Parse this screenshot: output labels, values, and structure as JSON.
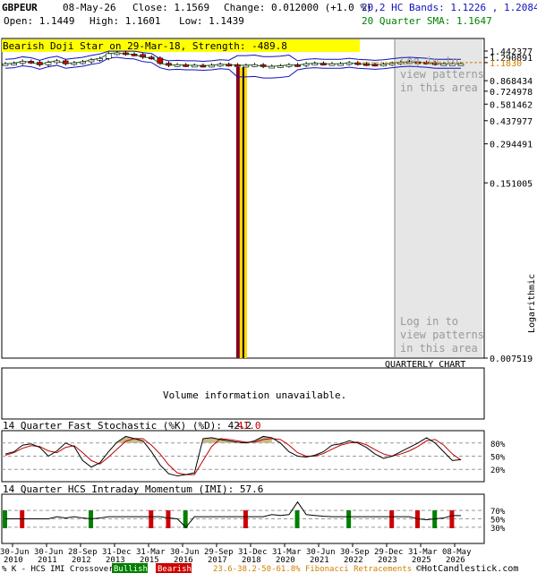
{
  "header": {
    "symbol": "GBPEUR",
    "date": "08-May-26",
    "close": "Close: 1.1569",
    "change": "Change: 0.012000 (+1.0 %)",
    "open": "Open: 1.1449",
    "high": "High: 1.1601",
    "low": "Low: 1.1439",
    "bands": "20,2 HC Bands: 1.1226 , 1.2084",
    "sma": "20 Quarter SMA: 1.1647"
  },
  "colors": {
    "bands": "#1010c0",
    "sma": "#008000",
    "bull": "#008000",
    "bear": "#d00000",
    "pattern_banner": "#ffff00",
    "pattern_bar_dark": "#800020",
    "pattern_bar_light": "#ffd700",
    "login_panel": "#e6e6e6",
    "stoch_k": "#000000",
    "stoch_d": "#c00000",
    "stoch_fill": "#c8b98c",
    "fib": "#d08000"
  },
  "pattern_banner": "Bearish Doji Star on 29-Mar-18, Strength: -489.8",
  "login_text": [
    "Log in to",
    "view patterns",
    "in this area"
  ],
  "chart_label": "QUARTERLY CHART",
  "y_axis_label": "Logarithmic",
  "volume_text": "Volume information unavailable.",
  "stoch_title": "14 Quarter Fast Stochastic (%K) (%D): 42.2",
  "stoch_d_value": "41.0",
  "imi_title": "14 Quarter HCS Intraday Momentum (IMI): 57.6",
  "footer": {
    "crossover": "% K - HCS IMI Crossover:",
    "bullish": "Bullish",
    "bearish": "Bearish",
    "fib": "23.6-38.2-50-61.8% Fibonacci Retracements",
    "copyright": "©HotCandlestick.com"
  },
  "chart_data": {
    "type": "candlestick",
    "scale": "logarithmic",
    "ylim": [
      0.007519,
      1.442377
    ],
    "y_ticks": [
      "1.442377",
      "1.290891",
      "1.1830",
      "0.868434",
      "0.724978",
      "0.581462",
      "0.437977",
      "0.294491",
      "0.151005",
      "0.007519"
    ],
    "y_tick_values": [
      1.442377,
      1.290891,
      1.183,
      0.868434,
      0.724978,
      0.581462,
      0.437977,
      0.294491,
      0.151005,
      0.007519
    ],
    "x_ticks": [
      [
        "30-Jun",
        "2010"
      ],
      [
        "30-Jun",
        "2011"
      ],
      [
        "28-Sep",
        "2012"
      ],
      [
        "31-Dec",
        "2013"
      ],
      [
        "31-Mar",
        "2015"
      ],
      [
        "30-Jun",
        "2016"
      ],
      [
        "29-Sep",
        "2017"
      ],
      [
        "31-Dec",
        "2018"
      ],
      [
        "31-Mar",
        "2020"
      ],
      [
        "30-Jun",
        "2021"
      ],
      [
        "30-Sep",
        "2022"
      ],
      [
        "29-Dec",
        "2023"
      ],
      [
        "31-Mar",
        "2025"
      ],
      [
        "08-May",
        "2026"
      ]
    ],
    "pattern_date": "29-Mar-18",
    "close_values": [
      1.16,
      1.17,
      1.21,
      1.19,
      1.14,
      1.19,
      1.22,
      1.16,
      1.18,
      1.2,
      1.24,
      1.27,
      1.38,
      1.4,
      1.37,
      1.36,
      1.3,
      1.28,
      1.17,
      1.13,
      1.14,
      1.13,
      1.13,
      1.12,
      1.13,
      1.15,
      1.14,
      1.13,
      1.13,
      1.14,
      1.11,
      1.11,
      1.12,
      1.14,
      1.13,
      1.16,
      1.17,
      1.16,
      1.16,
      1.16,
      1.18,
      1.16,
      1.15,
      1.14,
      1.15,
      1.17,
      1.19,
      1.2,
      1.19,
      1.18,
      1.16,
      1.16,
      1.16,
      1.16
    ],
    "stochastic": {
      "levels": [
        "80%",
        "50%",
        "20%"
      ],
      "k_series": [
        55,
        60,
        75,
        78,
        70,
        50,
        62,
        80,
        72,
        40,
        25,
        35,
        60,
        82,
        95,
        90,
        85,
        60,
        30,
        10,
        5,
        8,
        12,
        90,
        92,
        88,
        85,
        82,
        80,
        85,
        95,
        92,
        80,
        60,
        50,
        48,
        52,
        60,
        75,
        78,
        85,
        80,
        70,
        55,
        45,
        50,
        60,
        70,
        80,
        92,
        80,
        60,
        40,
        42.2
      ],
      "d_series": [
        52,
        58,
        68,
        74,
        72,
        62,
        58,
        70,
        74,
        58,
        40,
        32,
        48,
        66,
        84,
        90,
        90,
        75,
        55,
        30,
        12,
        8,
        8,
        40,
        72,
        90,
        88,
        85,
        82,
        82,
        88,
        90,
        88,
        75,
        58,
        50,
        50,
        56,
        66,
        75,
        80,
        82,
        76,
        65,
        55,
        50,
        55,
        62,
        72,
        85,
        88,
        75,
        55,
        41.0
      ]
    },
    "imi": {
      "levels": [
        "70%",
        "50%",
        "30%"
      ],
      "series": [
        50,
        50,
        50,
        50,
        50,
        50,
        55,
        52,
        55,
        52,
        50,
        52,
        55,
        55,
        55,
        55,
        55,
        55,
        55,
        52,
        50,
        30,
        55,
        55,
        55,
        55,
        55,
        55,
        55,
        55,
        55,
        60,
        58,
        60,
        90,
        60,
        58,
        56,
        55,
        55,
        55,
        55,
        55,
        55,
        55,
        55,
        55,
        55,
        50,
        48,
        50,
        52,
        57.6,
        57.6
      ],
      "bullish_idx": [
        0,
        10,
        21,
        34,
        40,
        50
      ],
      "bearish_idx": [
        2,
        17,
        19,
        28,
        45,
        48,
        52
      ]
    }
  }
}
